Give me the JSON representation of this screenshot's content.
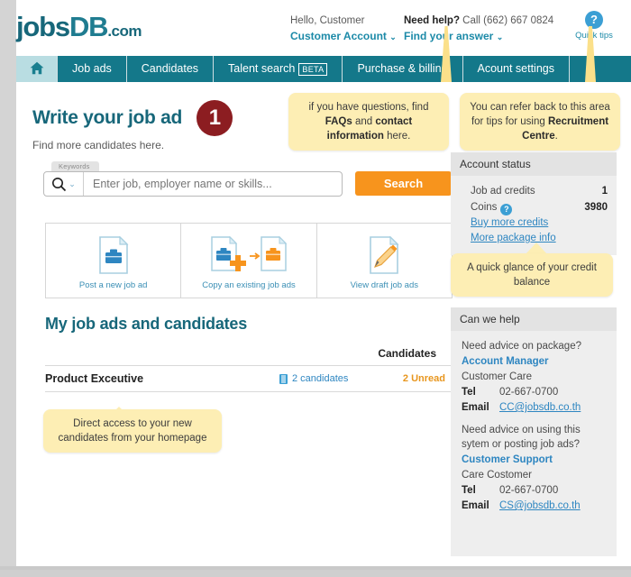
{
  "brand": {
    "logo_jobs": "jobs",
    "logo_db": "DB",
    "logo_dotcom": ".com",
    "teal": "#14788a",
    "orange": "#f7941d",
    "link_blue": "#2e86c1",
    "callout_yellow": "#fdeeb4",
    "badge_maroon": "#8c1d21"
  },
  "header": {
    "hello": "Hello, Customer",
    "account_link": "Customer Account",
    "need_help_bold": "Need help?",
    "need_help_rest": " Call (662) 667 0824",
    "find_answer": "Find your answer",
    "caret": "⌄",
    "quick_tips_label": "Quick tips",
    "quick_tips_icon": "?"
  },
  "nav": {
    "home_icon": "home-icon",
    "items": [
      {
        "label": "Job ads",
        "beta": ""
      },
      {
        "label": "Candidates",
        "beta": ""
      },
      {
        "label": "Talent search",
        "beta": "BETA"
      },
      {
        "label": "Purchase & billing",
        "beta": ""
      },
      {
        "label": "Acount settings",
        "beta": ""
      }
    ]
  },
  "callouts": {
    "faq": {
      "pre": "if you have questions, find ",
      "b1": "FAQs",
      "mid": " and ",
      "b2": "contact information",
      "post": " here."
    },
    "tips": {
      "pre": "You can refer back to this area for tips for using ",
      "b1": "Recruitment Centre",
      "post": "."
    },
    "credit": "A quick glance of your credit balance",
    "direct": "Direct access to your new candidates from your homepage"
  },
  "main": {
    "title": "Write your job ad",
    "step_badge": "1",
    "subtitle": "Find more candidates here.",
    "search": {
      "keywords_tab": "Keywords",
      "placeholder": "Enter job, employer name or skills...",
      "value": "",
      "button_label": "Search"
    },
    "cards": [
      {
        "label": "Post a new job ad",
        "icon": "new-job-ad-icon"
      },
      {
        "label": "Copy an existing job ads",
        "icon": "copy-job-ad-icon"
      },
      {
        "label": "View draft job ads",
        "icon": "draft-job-ad-icon"
      }
    ],
    "jobs_title": "My job ads and candidates",
    "table": {
      "header_candidates": "Candidates",
      "rows": [
        {
          "title": "Product Exceutive",
          "candidates": "2 candidates",
          "unread": "2 Unread"
        }
      ]
    }
  },
  "sidebar": {
    "account_status": {
      "heading": "Account status",
      "rows": [
        {
          "label": "Job ad credits",
          "value": "1",
          "help": ""
        },
        {
          "label": "Coins",
          "value": "3980",
          "help": "?"
        }
      ],
      "links": [
        "Buy more credits",
        "More package info"
      ]
    },
    "can_we_help": {
      "heading": "Can we help",
      "blocks": [
        {
          "question": "Need advice on package?",
          "name": "Account Manager",
          "sub": "Customer Care",
          "tel_label": "Tel",
          "tel": "02-667-0700",
          "email_label": "Email",
          "email": "CC@jobsdb.co.th"
        },
        {
          "question": "Need advice on using this sytem or posting job ads?",
          "name": "Customer Support",
          "sub": "Care Costomer",
          "tel_label": "Tel",
          "tel": "02-667-0700",
          "email_label": "Email",
          "email": "CS@jobsdb.co.th"
        }
      ]
    }
  }
}
